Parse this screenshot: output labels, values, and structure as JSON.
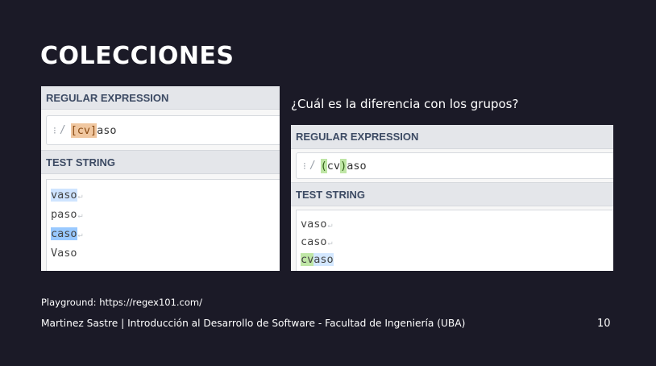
{
  "slide": {
    "title": "COLECCIONES",
    "question": "¿Cuál es la diferencia con los grupos?",
    "playground": "Playground: https://regex101.com/",
    "footer": "Martinez Sastre | Introducción al Desarrollo de Software - Facultad de Ingeniería (UBA)",
    "page_number": "10"
  },
  "left_panel": {
    "regex_header": "REGULAR EXPRESSION",
    "dots": "⁝",
    "delimiter": "/",
    "regex_highlight": "[cv]",
    "regex_rest": "aso",
    "test_header": "TEST STRING",
    "lines": [
      {
        "text": "vaso",
        "newline": "↵"
      },
      {
        "text": "paso",
        "newline": "↵"
      },
      {
        "text": "caso",
        "newline": "↵"
      },
      {
        "text": "Vaso",
        "newline": ""
      }
    ]
  },
  "right_panel": {
    "regex_header": "REGULAR EXPRESSION",
    "dots": "⁝",
    "delimiter": "/",
    "regex_open": "(",
    "regex_inner": "cv",
    "regex_close": ")",
    "regex_rest": "aso",
    "test_header": "TEST STRING",
    "lines": [
      {
        "text": "vaso",
        "newline": "↵"
      },
      {
        "text": "caso",
        "newline": "↵"
      },
      {
        "group_part": "cv",
        "rest_part": "aso"
      }
    ]
  },
  "colors": {
    "background": "#1b1a27",
    "match_blue": "#99c9ff",
    "match_blue_light": "#cfe4ff",
    "group_green": "#bfe6a6",
    "class_orange": "#f0c7a0"
  }
}
